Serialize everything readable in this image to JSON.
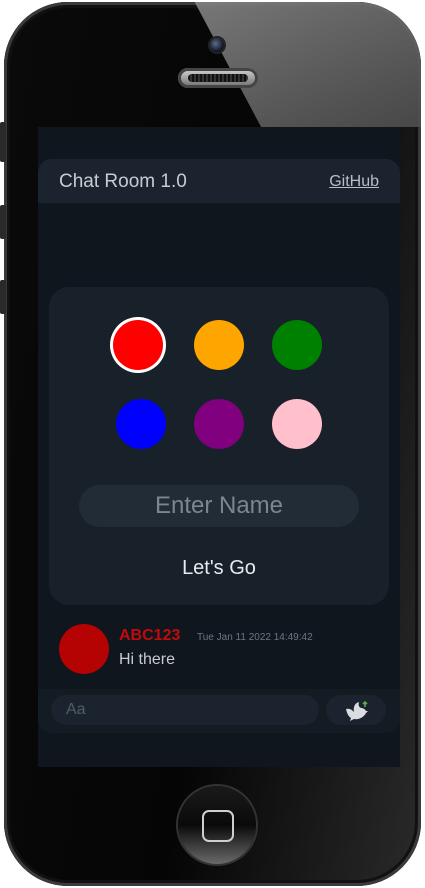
{
  "header": {
    "title": "Chat Room 1.0",
    "link_label": "GitHub"
  },
  "color_picker": {
    "options": [
      {
        "color": "#ff0000",
        "selected": true
      },
      {
        "color": "#ffa500",
        "selected": false
      },
      {
        "color": "#008000",
        "selected": false
      },
      {
        "color": "#0000ff",
        "selected": false
      },
      {
        "color": "#800080",
        "selected": false
      },
      {
        "color": "#ffc0cb",
        "selected": false
      }
    ]
  },
  "login": {
    "name_placeholder": "Enter Name",
    "go_label": "Let's Go"
  },
  "messages": [
    {
      "name": "ABC123",
      "name_color": "#c00b0b",
      "avatar_color": "#b50202",
      "timestamp": "Tue Jan 11 2022 14:49:42",
      "text": "Hi there"
    }
  ],
  "composer": {
    "placeholder": "Aa",
    "send_icon": "dove-icon"
  }
}
